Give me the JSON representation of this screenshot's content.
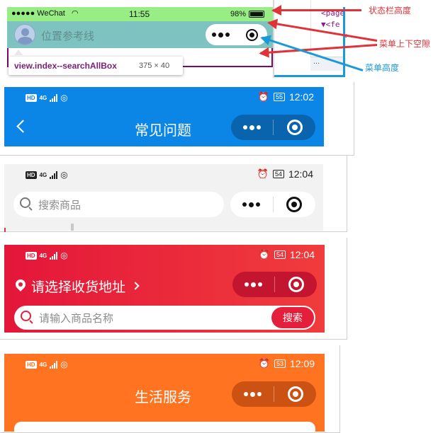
{
  "colors": {
    "wechat_statusbar": "#98ee85",
    "wechat_navbar": "#7fc3c1",
    "faq_blue": "#0b86e6",
    "faq_capsule": "#0a63ad",
    "search_gray": "#f2f2f2",
    "address_red": "#e51f3b",
    "address_capsule": "#c31530",
    "life_orange": "#ff7321",
    "life_capsule": "#cc5213",
    "annotation_red": "#e03339",
    "annotation_blue": "#1a9ad7"
  },
  "panel1": {
    "carrier": "●●●●● WeChat",
    "time": "11:55",
    "battery": "98%",
    "placeholder": "位置参考线",
    "tooltip_selector": "view.index--searchAllBox",
    "tooltip_size": "375 × 40",
    "devtools_lines": [
      "<page",
      "▼<fe",
      "<"
    ],
    "devtools_dots": "..."
  },
  "annotations": {
    "statusbar_height": "状态栏高度",
    "menu_padding": "菜单上下空隙",
    "menu_height": "菜单高度"
  },
  "panel2": {
    "status": {
      "hd": "HD",
      "net": "4G",
      "battery": "55",
      "time": "12:02"
    },
    "title": "常见问题"
  },
  "panel3": {
    "status": {
      "hd": "HD",
      "net": "4G",
      "battery": "54",
      "time": "12:04"
    },
    "placeholder": "搜索商品"
  },
  "panel4": {
    "status": {
      "hd": "HD",
      "net": "4G",
      "battery": "54",
      "time": "12:04"
    },
    "address": "请选择收货地址",
    "placeholder": "请输入商品名称",
    "search_button": "搜索"
  },
  "panel5": {
    "status": {
      "hd": "HD",
      "net": "4G",
      "battery": "53",
      "time": "12:09"
    },
    "title": "生活服务"
  }
}
